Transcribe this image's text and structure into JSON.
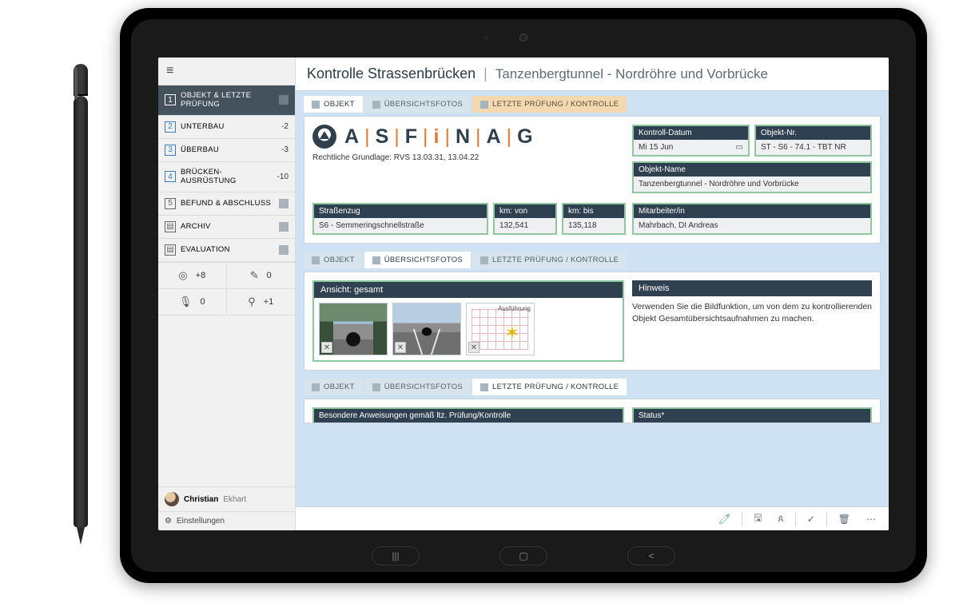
{
  "header": {
    "title": "Kontrolle Strassenbrücken",
    "subtitle": "Tanzenbergtunnel - Nordröhre und Vorbrücke"
  },
  "sidebar": {
    "items": [
      {
        "label": "OBJEKT & LETZTE PRÜFUNG",
        "count": "",
        "active": true
      },
      {
        "label": "UNTERBAU",
        "count": "-2"
      },
      {
        "label": "ÜBERBAU",
        "count": "-3"
      },
      {
        "label": "BRÜCKEN-AUSRÜSTUNG",
        "count": "-10"
      },
      {
        "label": "BEFUND & ABSCHLUSS",
        "count": ""
      },
      {
        "label": "ARCHIV",
        "count": ""
      },
      {
        "label": "EVALUATION",
        "count": ""
      }
    ],
    "tools": {
      "camera_count": "+8",
      "pen_count": "0",
      "mic_count": "0",
      "key_count": "+1"
    },
    "user_first": "Christian",
    "user_last": "Ekhart",
    "settings_label": "Einstellungen"
  },
  "tabs": {
    "objekt": "OBJEKT",
    "fotos": "ÜBERSICHTSFOTOS",
    "pruefung": "LETZTE PRÜFUNG / KONTROLLE"
  },
  "objekt": {
    "logo_text": "ASFINAG",
    "legal": "Rechtliche Grundlage: RVS 13.03.31, 13.04.22",
    "kontroll_datum_label": "Kontroll-Datum",
    "kontroll_datum_value": "Mi 15 Jun",
    "objekt_nr_label": "Objekt-Nr.",
    "objekt_nr_value": "ST - S6 - 74.1 - TBT NR",
    "objekt_name_label": "Objekt-Name",
    "objekt_name_value": "Tanzenbergtunnel - Nordröhre und Vorbrücke",
    "strassenzug_label": "Straßenzug",
    "strassenzug_value": "S6 - Semmeringschnellstraße",
    "km_von_label": "km: von",
    "km_von_value": "132,541",
    "km_bis_label": "km: bis",
    "km_bis_value": "135,118",
    "mitarbeiter_label": "Mitarbeiter/in",
    "mitarbeiter_value": "Mahrbach, DI Andreas"
  },
  "fotos": {
    "ansicht_label": "Ansicht: gesamt",
    "diagram_label": "Ausführung",
    "hinweis_label": "Hinweis",
    "hinweis_text": "Verwenden Sie die Bildfunktion, um von dem zu kontrollierenden Objekt Gesamtübersichtsaufnahmen zu machen."
  },
  "pruefung": {
    "anweisungen_label": "Besondere Anweisungen gemäß ltz. Prüfung/Kontrolle",
    "status_label": "Status*"
  },
  "icons": {
    "hamburger": "≡",
    "calendar": "🗓",
    "camera": "📷",
    "pencil": "✎",
    "mic": "🎤",
    "key": "⚿",
    "gear": "⚙",
    "attach": "📎",
    "save": "💾",
    "user": "👤",
    "check": "✓",
    "trash": "🗑",
    "more": "⋯",
    "close": "✕"
  }
}
